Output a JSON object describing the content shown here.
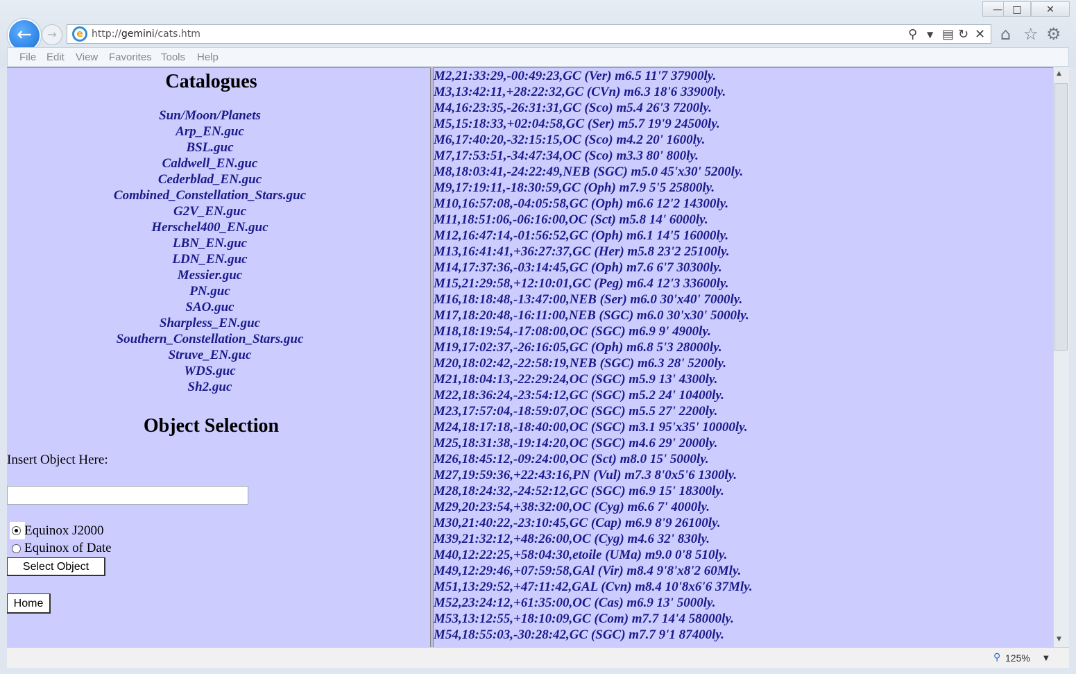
{
  "browser": {
    "url_prefix": "http://",
    "url_host": "gemini",
    "url_path": "/cats.htm",
    "menu": [
      "File",
      "Edit",
      "View",
      "Favorites",
      "Tools",
      "Help"
    ],
    "zoom": "125%"
  },
  "left": {
    "catalogues_title": "Catalogues",
    "catalogues": [
      "Sun/Moon/Planets",
      "Arp_EN.guc",
      "BSL.guc",
      "Caldwell_EN.guc",
      "Cederblad_EN.guc",
      "Combined_Constellation_Stars.guc",
      "G2V_EN.guc",
      "Herschel400_EN.guc",
      "LBN_EN.guc",
      "LDN_EN.guc",
      "Messier.guc",
      "PN.guc",
      "SAO.guc",
      "Sharpless_EN.guc",
      "Southern_Constellation_Stars.guc",
      "Struve_EN.guc",
      "WDS.guc",
      "Sh2.guc"
    ],
    "selection_title": "Object Selection",
    "insert_label": "Insert Object Here:",
    "input_value": "",
    "radio_j2000": "Equinox J2000",
    "radio_date": "Equinox of Date",
    "selected_equinox": "J2000",
    "select_button": "Select Object",
    "home_button": "Home"
  },
  "right": {
    "objects": [
      "M2,21:33:29,-00:49:23,GC (Ver) m6.5 11'7 37900ly.",
      "M3,13:42:11,+28:22:32,GC (CVn) m6.3 18'6 33900ly.",
      "M4,16:23:35,-26:31:31,GC (Sco) m5.4 26'3 7200ly.",
      "M5,15:18:33,+02:04:58,GC (Ser) m5.7 19'9 24500ly.",
      "M6,17:40:20,-32:15:15,OC (Sco) m4.2 20' 1600ly.",
      "M7,17:53:51,-34:47:34,OC (Sco) m3.3 80' 800ly.",
      "M8,18:03:41,-24:22:49,NEB (SGC) m5.0 45'x30' 5200ly.",
      "M9,17:19:11,-18:30:59,GC (Oph) m7.9 5'5 25800ly.",
      "M10,16:57:08,-04:05:58,GC (Oph) m6.6 12'2 14300ly.",
      "M11,18:51:06,-06:16:00,OC (Sct) m5.8 14' 6000ly.",
      "M12,16:47:14,-01:56:52,GC (Oph) m6.1 14'5 16000ly.",
      "M13,16:41:41,+36:27:37,GC (Her) m5.8 23'2 25100ly.",
      "M14,17:37:36,-03:14:45,GC (Oph) m7.6 6'7 30300ly.",
      "M15,21:29:58,+12:10:01,GC (Peg) m6.4 12'3 33600ly.",
      "M16,18:18:48,-13:47:00,NEB (Ser) m6.0 30'x40' 7000ly.",
      "M17,18:20:48,-16:11:00,NEB (SGC) m6.0 30'x30' 5000ly.",
      "M18,18:19:54,-17:08:00,OC (SGC) m6.9 9' 4900ly.",
      "M19,17:02:37,-26:16:05,GC (Oph) m6.8 5'3 28000ly.",
      "M20,18:02:42,-22:58:19,NEB (SGC) m6.3 28' 5200ly.",
      "M21,18:04:13,-22:29:24,OC (SGC) m5.9 13' 4300ly.",
      "M22,18:36:24,-23:54:12,GC (SGC) m5.2 24' 10400ly.",
      "M23,17:57:04,-18:59:07,OC (SGC) m5.5 27' 2200ly.",
      "M24,18:17:18,-18:40:00,OC (SGC) m3.1 95'x35' 10000ly.",
      "M25,18:31:38,-19:14:20,OC (SGC) m4.6 29' 2000ly.",
      "M26,18:45:12,-09:24:00,OC (Sct) m8.0 15' 5000ly.",
      "M27,19:59:36,+22:43:16,PN (Vul) m7.3 8'0x5'6 1300ly.",
      "M28,18:24:32,-24:52:12,GC (SGC) m6.9 15' 18300ly.",
      "M29,20:23:54,+38:32:00,OC (Cyg) m6.6 7' 4000ly.",
      "M30,21:40:22,-23:10:45,GC (Cap) m6.9 8'9 26100ly.",
      "M39,21:32:12,+48:26:00,OC (Cyg) m4.6 32' 830ly.",
      "M40,12:22:25,+58:04:30,etoile (UMa) m9.0 0'8 510ly.",
      "M49,12:29:46,+07:59:58,GAl (Vir) m8.4 9'8'x8'2 60Mly.",
      "M51,13:29:52,+47:11:42,GAL (Cvn) m8.4 10'8x6'6 37Mly.",
      "M52,23:24:12,+61:35:00,OC (Cas) m6.9 13' 5000ly.",
      "M53,13:12:55,+18:10:09,GC (Com) m7.7 14'4 58000ly.",
      "M54,18:55:03,-30:28:42,GC (SGC) m7.7 9'1 87400ly."
    ]
  }
}
